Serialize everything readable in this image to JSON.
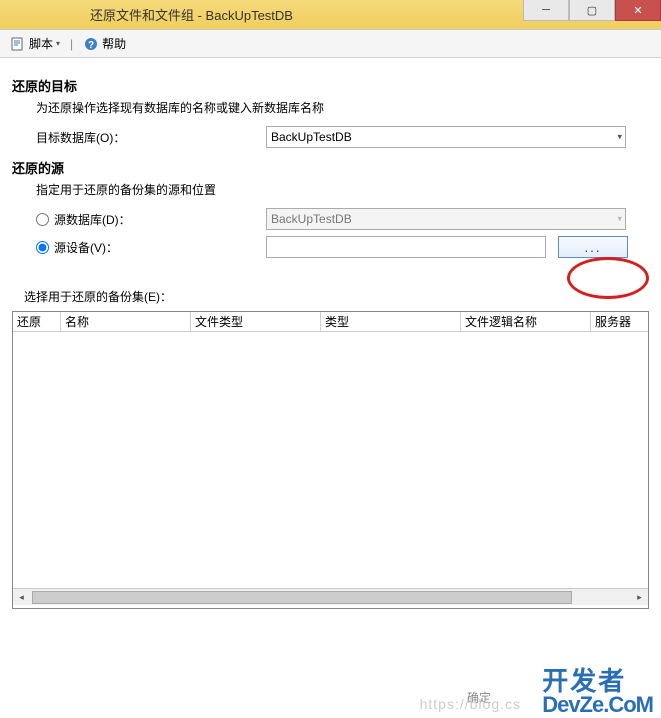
{
  "window": {
    "title": "还原文件和文件组 - BackUpTestDB"
  },
  "toolbar": {
    "script_label": "脚本",
    "help_label": "帮助"
  },
  "target": {
    "title": "还原的目标",
    "desc": "为还原操作选择现有数据库的名称或键入新数据库名称",
    "db_label": "目标数据库(O)：",
    "db_value": "BackUpTestDB"
  },
  "source": {
    "title": "还原的源",
    "desc": "指定用于还原的备份集的源和位置",
    "from_db_label": "源数据库(D)：",
    "from_db_value": "BackUpTestDB",
    "from_device_label": "源设备(V)：",
    "device_value": "",
    "browse_label": "..."
  },
  "backupset": {
    "label": "选择用于还原的备份集(E)：",
    "columns": [
      "还原",
      "名称",
      "文件类型",
      "类型",
      "文件逻辑名称",
      "服务器"
    ]
  },
  "bottom": {
    "ok_label": "确定"
  },
  "watermark": {
    "url": "https://blog.cs",
    "cn": "开发者",
    "en": "DevZe.CoM"
  }
}
